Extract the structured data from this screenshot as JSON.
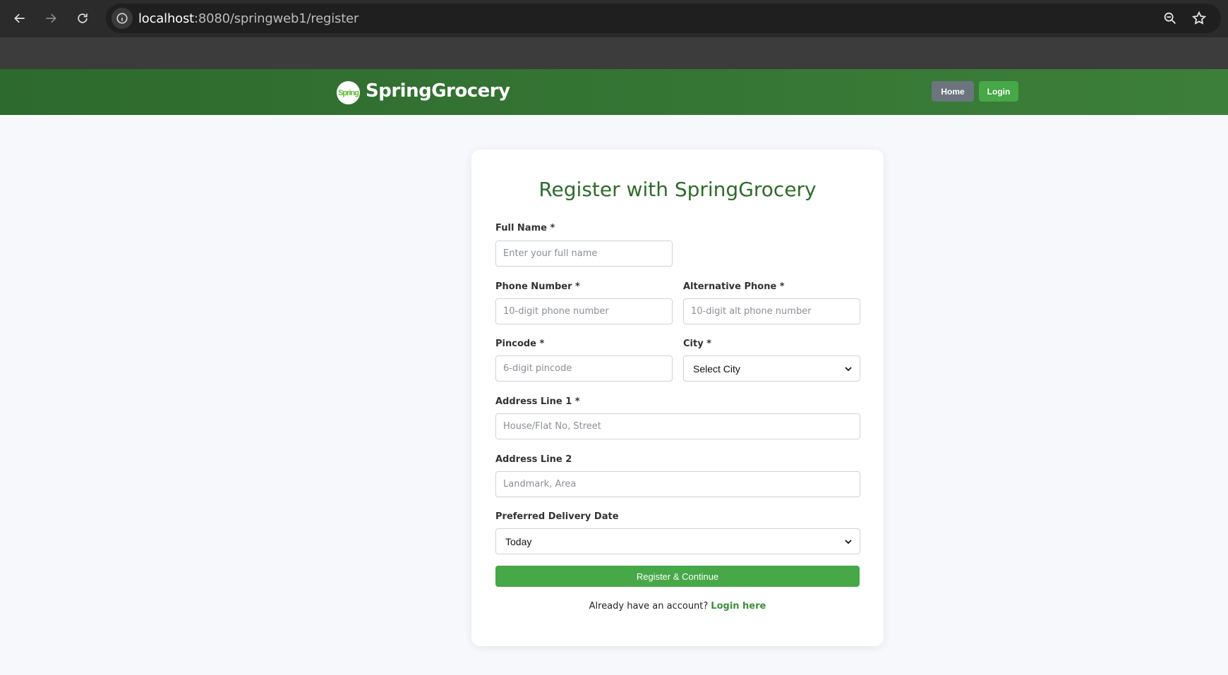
{
  "browser": {
    "url_host": "localhost",
    "url_rest": ":8080/springweb1/register"
  },
  "header": {
    "logo_text": "Spring",
    "brand": "SpringGrocery",
    "home_label": "Home",
    "login_label": "Login"
  },
  "form": {
    "title": "Register with SpringGrocery",
    "full_name": {
      "label": "Full Name *",
      "placeholder": "Enter your full name"
    },
    "phone": {
      "label": "Phone Number *",
      "placeholder": "10-digit phone number"
    },
    "alt_phone": {
      "label": "Alternative Phone *",
      "placeholder": "10-digit alt phone number"
    },
    "pincode": {
      "label": "Pincode *",
      "placeholder": "6-digit pincode"
    },
    "city": {
      "label": "City *",
      "selected": "Select City"
    },
    "address1": {
      "label": "Address Line 1 *",
      "placeholder": "House/Flat No, Street"
    },
    "address2": {
      "label": "Address Line 2",
      "placeholder": "Landmark, Area"
    },
    "delivery_date": {
      "label": "Preferred Delivery Date",
      "selected": "Today"
    },
    "submit_label": "Register & Continue",
    "footer_text": "Already have an account?",
    "footer_link": "Login here"
  },
  "colors": {
    "header_green": "#2d6a2d",
    "accent_green": "#46a847",
    "title_green": "#2e6b2b",
    "home_gray": "#6c757d"
  }
}
